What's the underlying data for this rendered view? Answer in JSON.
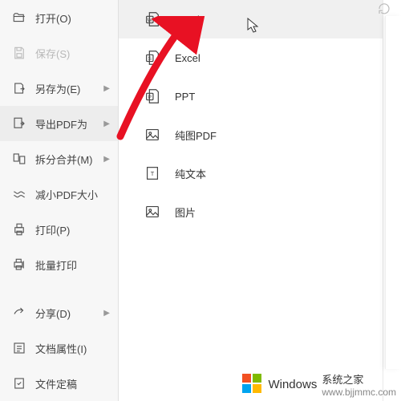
{
  "sidebar": {
    "items": [
      {
        "label": "打开(O)"
      },
      {
        "label": "保存(S)"
      },
      {
        "label": "另存为(E)"
      },
      {
        "label": "导出PDF为"
      },
      {
        "label": "拆分合并(M)"
      },
      {
        "label": "减小PDF大小"
      },
      {
        "label": "打印(P)"
      },
      {
        "label": "批量打印"
      },
      {
        "label": "分享(D)"
      },
      {
        "label": "文档属性(I)"
      },
      {
        "label": "文件定稿"
      }
    ]
  },
  "submenu": {
    "items": [
      {
        "label": "Word"
      },
      {
        "label": "Excel"
      },
      {
        "label": "PPT"
      },
      {
        "label": "纯图PDF"
      },
      {
        "label": "纯文本"
      },
      {
        "label": "图片"
      }
    ]
  },
  "watermark": {
    "brand": "Windows",
    "sub": "系统之家",
    "url": "www.bjjmmc.com"
  }
}
